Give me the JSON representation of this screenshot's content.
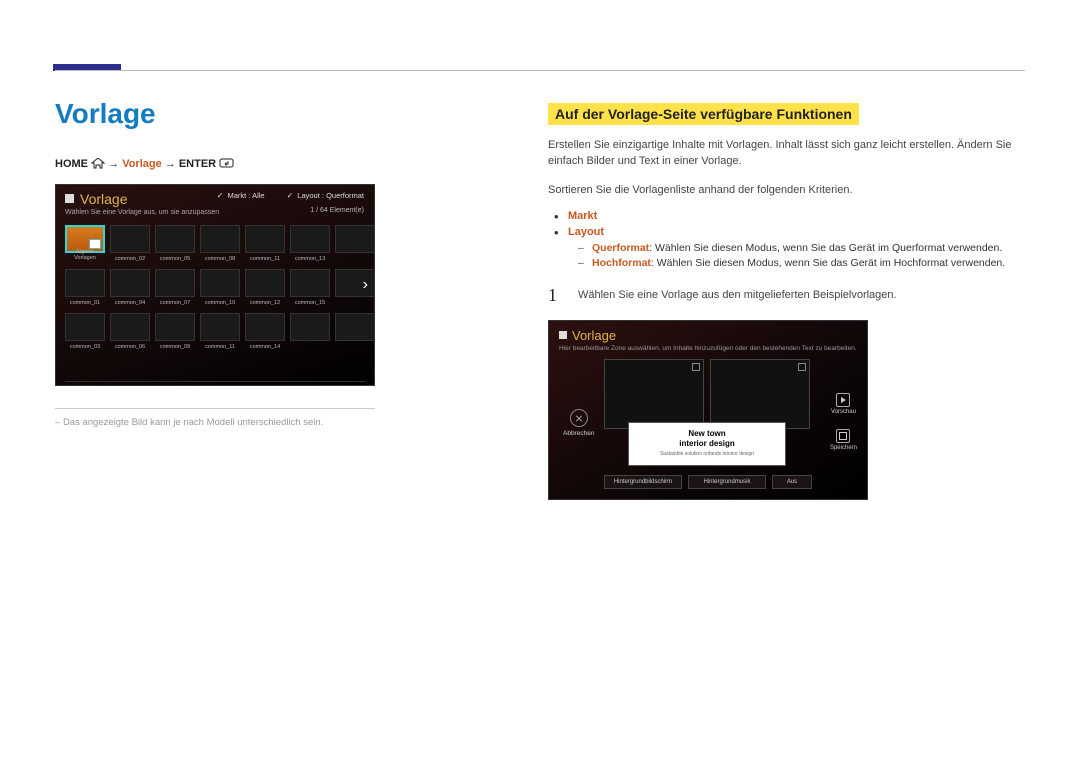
{
  "page": {
    "title": "Vorlage"
  },
  "breadcrumb": {
    "home": "HOME",
    "arrow": "→",
    "current": "Vorlage",
    "enter": "ENTER"
  },
  "shot1": {
    "title": "Vorlage",
    "subtitle": "Wählen Sie eine Vorlage aus, um sie anzupassen",
    "filter_market": "Markt : Alle",
    "filter_layout": "Layout : Querformat",
    "counter": "1 / 64 Element(e)",
    "first_tile_label": "Eigene Vorlagen",
    "tile_labels_row1": [
      "common_02",
      "common_05",
      "common_08",
      "common_11",
      "common_13",
      ""
    ],
    "tile_labels_row2": [
      "common_01",
      "common_04",
      "common_07",
      "common_10",
      "common_12",
      "common_15"
    ],
    "tile_labels_row3": [
      "common_03",
      "common_06",
      "common_09",
      "common_11",
      "common_14",
      ""
    ]
  },
  "footnote": "Das angezeigte Bild kann je nach Modell unterschiedlich sein.",
  "section": {
    "heading": "Auf der Vorlage-Seite verfügbare Funktionen",
    "para1": "Erstellen Sie einzigartige Inhalte mit Vorlagen. Inhalt lässt sich ganz leicht erstellen. Ändern Sie einfach Bilder und Text in einer Vorlage.",
    "para2": "Sortieren Sie die Vorlagenliste anhand der folgenden Kriterien.",
    "bullet_markt": "Markt",
    "bullet_layout": "Layout",
    "quer_label": "Querformat",
    "quer_text": ": Wählen Sie diesen Modus, wenn Sie das Gerät im Querformat verwenden.",
    "hoch_label": "Hochformat",
    "hoch_text": ": Wählen Sie diesen Modus, wenn Sie das Gerät im Hochformat verwenden.",
    "step1_num": "1",
    "step1_text": "Wählen Sie eine Vorlage aus den mitgelieferten Beispielvorlagen."
  },
  "shot2": {
    "title": "Vorlage",
    "subtitle": "Hier bearbeitbare Zone auswählen, um Inhalte hinzuzufügen oder den bestehenden Text zu bearbeiten.",
    "cancel": "Abbrechen",
    "preview": "Vorschau",
    "save": "Speichern",
    "card_line1": "New town",
    "card_line2": "interior design",
    "card_line3": "Sustainble solution orifands intorior design",
    "bg_image": "Hintergrundbildschirm",
    "bg_music": "Hintergrundmusik",
    "off": "Aus"
  }
}
